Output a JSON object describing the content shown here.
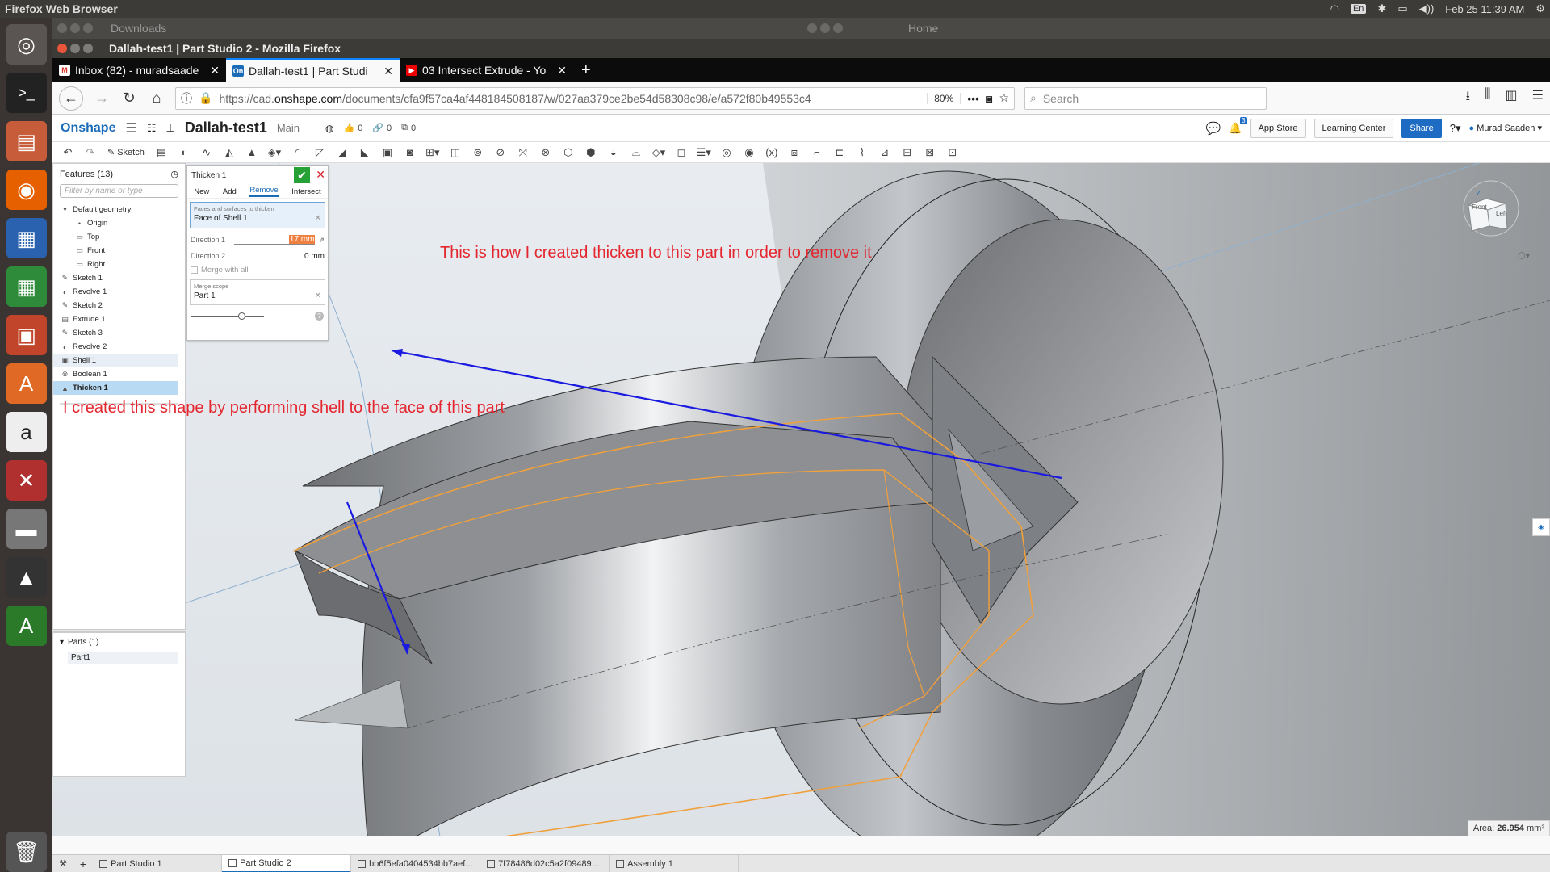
{
  "os_bar": {
    "title": "Firefox Web Browser",
    "keyboard": "En",
    "datetime": "Feb 25 11:39 AM"
  },
  "bg_windows": {
    "left_title": "Downloads",
    "right_title": "Home"
  },
  "firefox": {
    "window_title": "Dallah-test1 | Part Studio 2 - Mozilla Firefox",
    "tabs": [
      {
        "label": "Inbox (82) - muradsaade",
        "favicon": "gmail-icon",
        "active": false
      },
      {
        "label": "Dallah-test1 | Part Studi",
        "favicon": "onshape-icon",
        "active": true
      },
      {
        "label": "03 Intersect Extrude - Yo",
        "favicon": "youtube-icon",
        "active": false
      }
    ],
    "url_prefix": "https://cad.",
    "url_domain": "onshape.com",
    "url_rest": "/documents/cfa9f57ca4af448184508187/w/027aa379ce2be54d58308c98/e/a572f80b49553c4",
    "zoom": "80%",
    "search_placeholder": "Search"
  },
  "onshape": {
    "logo": "Onshape",
    "doc_title": "Dallah-test1",
    "branch": "Main",
    "likes": "0",
    "links": "0",
    "copies": "0",
    "app_store": "App Store",
    "learning_center": "Learning Center",
    "share": "Share",
    "user": "Murad Saadeh",
    "notif_count": "3",
    "sketch_label": "Sketch"
  },
  "features": {
    "title": "Features (13)",
    "filter_placeholder": "Filter by name or type",
    "default_geometry": "Default geometry",
    "items": [
      {
        "label": "Origin",
        "icon": "origin-icon"
      },
      {
        "label": "Top",
        "icon": "plane-icon"
      },
      {
        "label": "Front",
        "icon": "plane-icon"
      },
      {
        "label": "Right",
        "icon": "plane-icon"
      },
      {
        "label": "Sketch 1",
        "icon": "sketch-icon"
      },
      {
        "label": "Revolve 1",
        "icon": "revolve-icon"
      },
      {
        "label": "Sketch 2",
        "icon": "sketch-icon"
      },
      {
        "label": "Extrude 1",
        "icon": "extrude-icon"
      },
      {
        "label": "Sketch 3",
        "icon": "sketch-icon"
      },
      {
        "label": "Revolve 2",
        "icon": "revolve-icon"
      },
      {
        "label": "Shell 1",
        "icon": "shell-icon"
      },
      {
        "label": "Boolean 1",
        "icon": "boolean-icon"
      },
      {
        "label": "Thicken 1",
        "icon": "thicken-icon"
      }
    ],
    "parts_title": "Parts (1)",
    "parts": [
      "Part1"
    ]
  },
  "thicken": {
    "title": "Thicken 1",
    "modes": [
      "New",
      "Add",
      "Remove",
      "Intersect"
    ],
    "active_mode": "Remove",
    "faces_label": "Faces and surfaces to thicken",
    "faces_value": "Face of Shell 1",
    "direction1_label": "Direction 1",
    "direction1_value": "17 mm",
    "direction2_label": "Direction 2",
    "direction2_value": "0 mm",
    "merge_all": "Merge with all",
    "merge_scope_label": "Merge scope",
    "merge_scope_value": "Part 1"
  },
  "annotations": {
    "top": "This is how I created thicken to this part in order to remove it",
    "bottom": "I created this shape by performing shell to the face of this part"
  },
  "viewcube": {
    "front": "Front",
    "left": "Left"
  },
  "area_label": "Area:",
  "area_value": "26.954",
  "area_unit": "mm²",
  "bottom_tabs": [
    {
      "label": "Part Studio 1",
      "active": false
    },
    {
      "label": "Part Studio 2",
      "active": true
    },
    {
      "label": "bb6f5efa0404534bb7aef...",
      "active": false
    },
    {
      "label": "7f78486d02c5a2f09489...",
      "active": false
    },
    {
      "label": "Assembly 1",
      "active": false
    }
  ],
  "colors": {
    "annotation": "#e4262f",
    "arrow": "#1a1ae0",
    "highlight": "#f0a03c",
    "accent": "#1a6bb8"
  }
}
